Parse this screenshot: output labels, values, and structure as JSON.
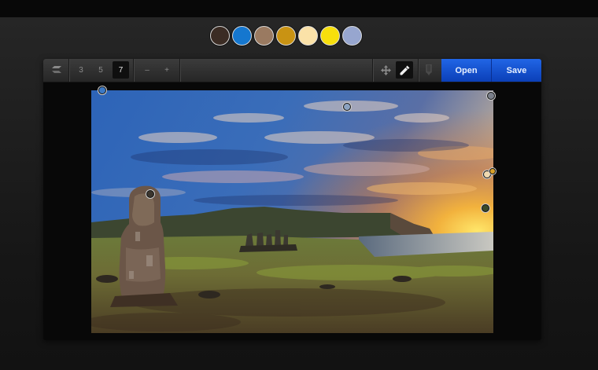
{
  "palette": [
    {
      "name": "swatch-dark-brown",
      "color": "#3b2c24"
    },
    {
      "name": "swatch-blue",
      "color": "#1577cf"
    },
    {
      "name": "swatch-taupe",
      "color": "#9a7a61"
    },
    {
      "name": "swatch-mustard",
      "color": "#c99313"
    },
    {
      "name": "swatch-cream",
      "color": "#fbe2a8"
    },
    {
      "name": "swatch-yellow",
      "color": "#f7df0c"
    },
    {
      "name": "swatch-lavender",
      "color": "#97a6cf"
    }
  ],
  "toolbar": {
    "brush_sizes": [
      "3",
      "5",
      "7"
    ],
    "active_size": "7",
    "minus_label": "–",
    "plus_label": "+",
    "open_label": "Open",
    "save_label": "Save"
  },
  "sample_points": [
    {
      "color": "#3c79c5"
    },
    {
      "color": "#8ca3c0"
    },
    {
      "color": "#7a7f8a"
    },
    {
      "color": "#3b352e"
    },
    {
      "color": "#efd9b0"
    },
    {
      "color": "#d9a12a"
    },
    {
      "color": "#3a4a2a"
    }
  ]
}
